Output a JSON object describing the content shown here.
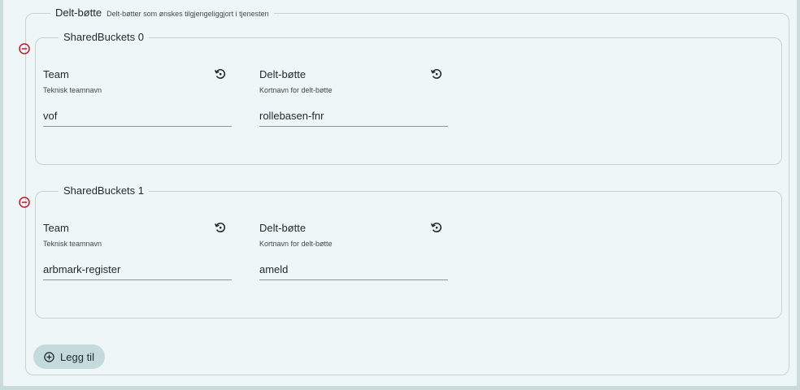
{
  "section": {
    "title": "Delt-bøtte",
    "description": "Delt-bøtter som ønskes tilgjengeliggjort i tjenesten"
  },
  "items": [
    {
      "legend": "SharedBuckets 0",
      "team": {
        "label": "Team",
        "help": "Teknisk teamnavn",
        "value": "vof"
      },
      "bucket": {
        "label": "Delt-bøtte",
        "help": "Kortnavn for delt-bøtte",
        "value": "rollebasen-fnr"
      }
    },
    {
      "legend": "SharedBuckets 1",
      "team": {
        "label": "Team",
        "help": "Teknisk teamnavn",
        "value": "arbmark-register"
      },
      "bucket": {
        "label": "Delt-bøtte",
        "help": "Kortnavn for delt-bøtte",
        "value": "ameld"
      }
    }
  ],
  "add_button": {
    "label": "Legg til",
    "icon": "plus-circle-icon"
  },
  "colors": {
    "background": "#eff6f8",
    "outer": "#c9dcdb",
    "remove": "#c0182a",
    "add_button_bg": "#c4dbdb"
  }
}
